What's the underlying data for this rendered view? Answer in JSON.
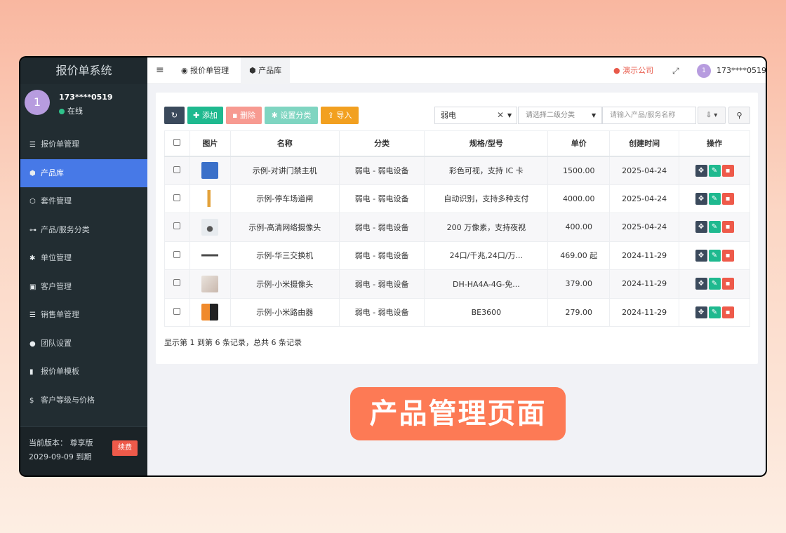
{
  "sidebar": {
    "brand": "报价单系统",
    "user": {
      "avatar_initial": "1",
      "name": "173****0519",
      "status": "在线"
    },
    "items": [
      {
        "icon": "list-icon",
        "glyph": "☰",
        "label": "报价单管理"
      },
      {
        "icon": "cube-icon",
        "glyph": "⬢",
        "label": "产品库"
      },
      {
        "icon": "cubes-icon",
        "glyph": "⬡",
        "label": "套件管理"
      },
      {
        "icon": "sitemap-icon",
        "glyph": "⊶",
        "label": "产品/服务分类"
      },
      {
        "icon": "gear-icon",
        "glyph": "✱",
        "label": "单位管理"
      },
      {
        "icon": "id-card-icon",
        "glyph": "▣",
        "label": "客户管理"
      },
      {
        "icon": "list-icon",
        "glyph": "☰",
        "label": "销售单管理"
      },
      {
        "icon": "users-icon",
        "glyph": "●",
        "label": "团队设置"
      },
      {
        "icon": "file-icon",
        "glyph": "▮",
        "label": "报价单模板"
      },
      {
        "icon": "dollar-icon",
        "glyph": "$",
        "label": "客户等级与价格"
      }
    ],
    "active_index": 1,
    "footer": {
      "version_label": "当前版本：  尊享版",
      "expiry": "2029-09-09 到期",
      "renew_label": "续费"
    }
  },
  "topbar": {
    "tabs": [
      {
        "label": "报价单管理"
      },
      {
        "label": "产品库"
      }
    ],
    "company": "演示公司",
    "avatar_initial": "1",
    "user": "173****0519"
  },
  "toolbar": {
    "add_label": "添加",
    "delete_label": "删除",
    "category_label": "设置分类",
    "import_label": "导入",
    "category_select_value": "弱电",
    "subcategory_placeholder": "请选择二级分类",
    "search_placeholder": "请输入产品/服务名称"
  },
  "table": {
    "headers": [
      "图片",
      "名称",
      "分类",
      "规格/型号",
      "单价",
      "创建时间",
      "操作"
    ],
    "rows": [
      {
        "name": "示例-对讲门禁主机",
        "category": "弱电 - 弱电设备",
        "spec": "彩色可视，支持 IC 卡",
        "price": "1500.00",
        "created": "2025-04-24",
        "thumb": "#3a70c9"
      },
      {
        "name": "示例-停车场道闸",
        "category": "弱电 - 弱电设备",
        "spec": "自动识别，支持多种支付",
        "price": "4000.00",
        "created": "2025-04-24",
        "thumb": "#e3a13a"
      },
      {
        "name": "示例-高清网络摄像头",
        "category": "弱电 - 弱电设备",
        "spec": "200 万像素，支持夜视",
        "price": "400.00",
        "created": "2025-04-24",
        "thumb": "#d7dde3"
      },
      {
        "name": "示例-华三交换机",
        "category": "弱电 - 弱电设备",
        "spec": "24口/千兆,24口/万...",
        "price": "469.00 起",
        "created": "2024-11-29",
        "thumb": "#4a4a4a"
      },
      {
        "name": "示例-小米摄像头",
        "category": "弱电 - 弱电设备",
        "spec": "DH-HA4A-4G-免...",
        "price": "379.00",
        "created": "2024-11-29",
        "thumb": "#c9b8ad"
      },
      {
        "name": "示例-小米路由器",
        "category": "弱电 - 弱电设备",
        "spec": "BE3600",
        "price": "279.00",
        "created": "2024-11-29",
        "thumb": "#f08a2c"
      }
    ]
  },
  "summary": "显示第 1 到第 6 条记录，总共 6 条记录",
  "banner": "产品管理页面"
}
